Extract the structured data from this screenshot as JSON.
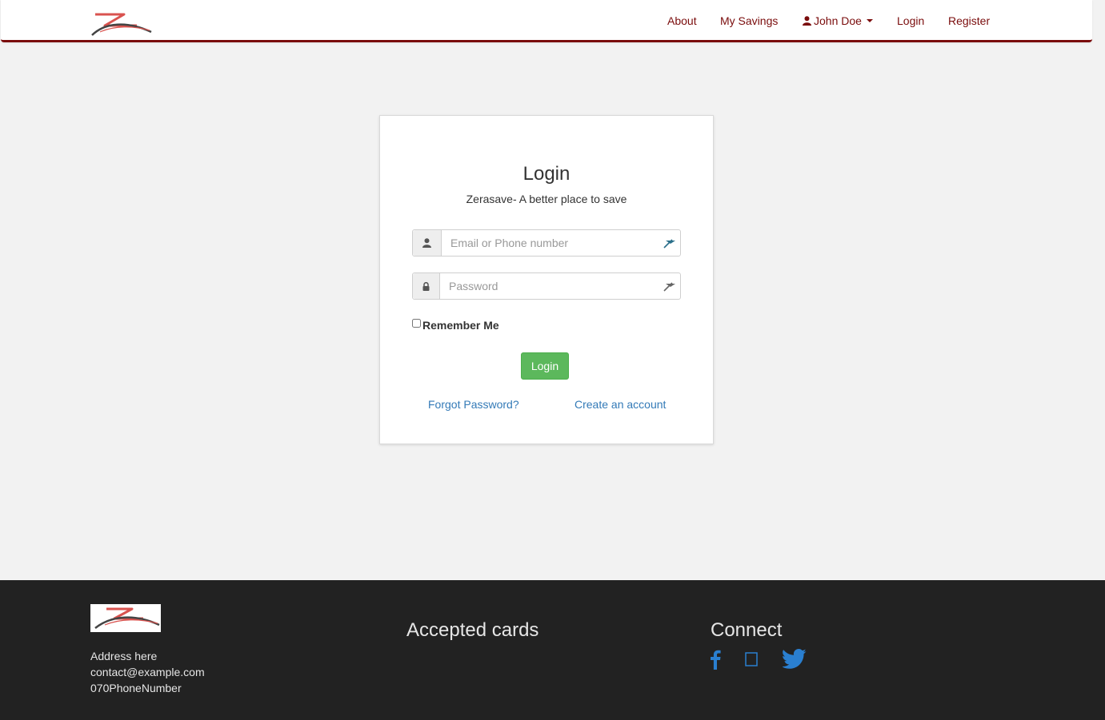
{
  "navbar": {
    "links": [
      {
        "label": "About"
      },
      {
        "label": "My Savings"
      },
      {
        "label": "John Doe"
      },
      {
        "label": "Login"
      },
      {
        "label": "Register"
      }
    ]
  },
  "login": {
    "title": "Login",
    "subtitle": "Zerasave- A better place to save",
    "email_placeholder": "Email or Phone number",
    "password_placeholder": "Password",
    "remember_label": "Remember Me",
    "submit_label": "Login",
    "forgot_link": "Forgot Password?",
    "create_link": "Create an account"
  },
  "footer": {
    "address": "Address here",
    "email": "contact@example.com",
    "phone": "070PhoneNumber",
    "cards_heading": "Accepted cards",
    "connect_heading": "Connect",
    "social": [
      "facebook-icon",
      "instagram-icon",
      "twitter-icon"
    ]
  },
  "colors": {
    "brand": "#7a0c0c",
    "success": "#5cb85c",
    "link": "#337ab7",
    "footer_bg": "#222222",
    "page_bg": "#f2f2f2",
    "social": "#2a7fd0"
  }
}
